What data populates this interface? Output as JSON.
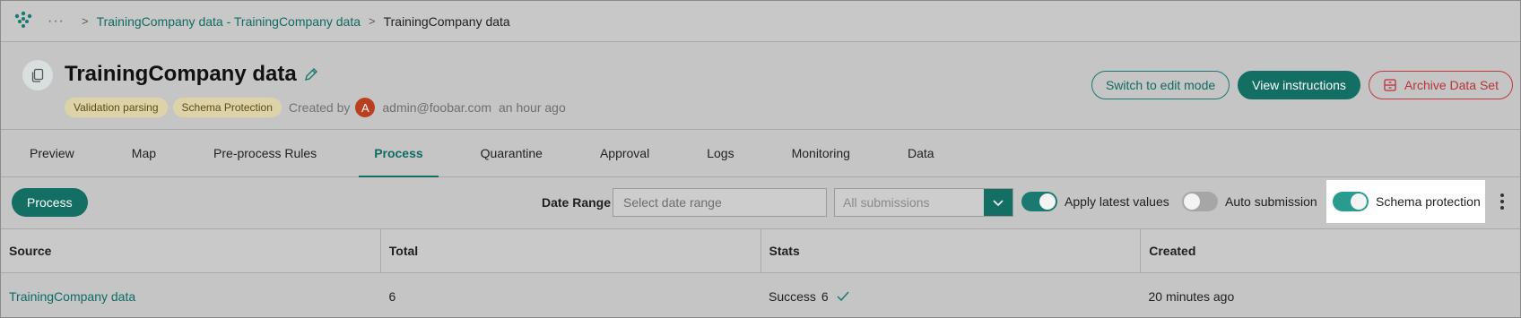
{
  "breadcrumb": {
    "dots": "···",
    "parent": "TrainingCompany data - TrainingCompany data",
    "current": "TrainingCompany data"
  },
  "header": {
    "title": "TrainingCompany data",
    "tags": [
      "Validation parsing",
      "Schema Protection"
    ],
    "created_by_label": "Created by",
    "avatar_initial": "A",
    "creator": "admin@foobar.com",
    "created_when": "an hour ago",
    "actions": {
      "edit_mode": "Switch to edit mode",
      "view_instructions": "View instructions",
      "archive": "Archive Data Set"
    }
  },
  "tabs": [
    "Preview",
    "Map",
    "Pre-process Rules",
    "Process",
    "Quarantine",
    "Approval",
    "Logs",
    "Monitoring",
    "Data"
  ],
  "active_tab": "Process",
  "toolbar": {
    "process_label": "Process",
    "date_range_label": "Date Range",
    "date_range_placeholder": "Select date range",
    "submissions_value": "All submissions",
    "apply_latest_label": "Apply latest values",
    "apply_latest_on": true,
    "auto_submission_label": "Auto submission",
    "auto_submission_on": false,
    "schema_protection_label": "Schema protection",
    "schema_protection_on": true
  },
  "table": {
    "columns": [
      "Source",
      "Total",
      "Stats",
      "Created"
    ],
    "rows": [
      {
        "source": "TrainingCompany data",
        "total": "6",
        "stats_label": "Success",
        "stats_count": "6",
        "created": "20 minutes ago"
      }
    ]
  },
  "colors": {
    "accent": "#136e64",
    "danger": "#b8343a",
    "tag_bg": "#ded3a8",
    "avatar": "#b8401f"
  }
}
